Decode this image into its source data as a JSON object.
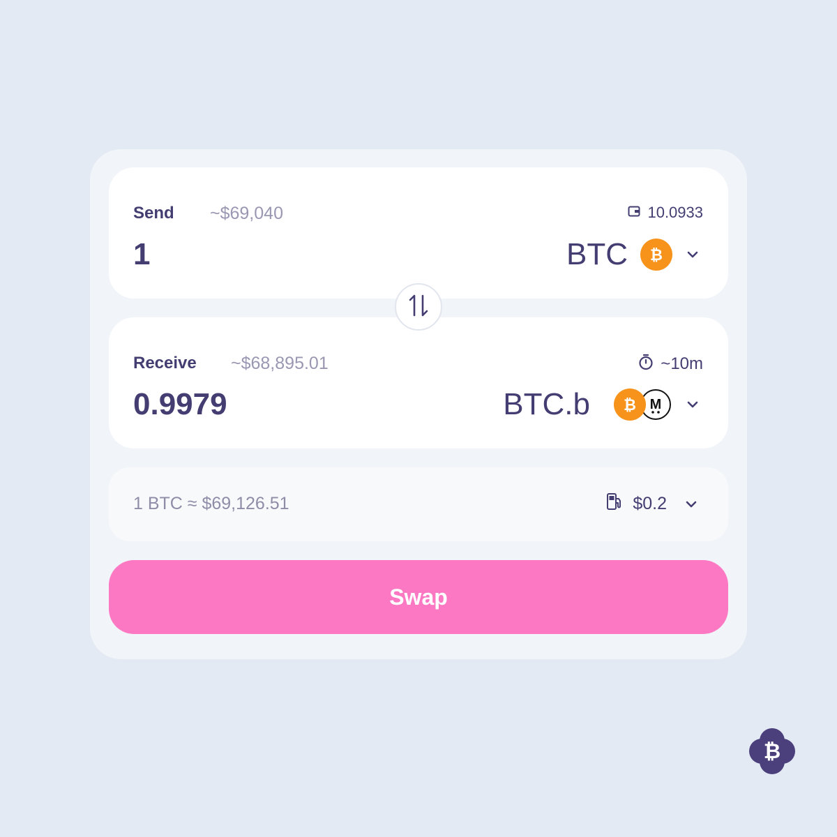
{
  "send": {
    "label": "Send",
    "usd_value": "~$69,040",
    "balance": "10.0933",
    "amount": "1",
    "token": "BTC"
  },
  "receive": {
    "label": "Receive",
    "usd_value": "~$68,895.01",
    "eta": "~10m",
    "amount": "0.9979",
    "token": "BTC.b"
  },
  "rate": {
    "text": "1 BTC ≈ $69,126.51",
    "gas_fee": "$0.2"
  },
  "swap_button": {
    "label": "Swap"
  },
  "colors": {
    "background": "#e3eaf3",
    "card": "#f1f4f8",
    "text": "#433d72",
    "muted": "#9a97b3",
    "btc_orange": "#f7931a",
    "swap_pink": "#fd78c3"
  },
  "icons": [
    "wallet-icon",
    "btc-coin-icon",
    "chevron-down-icon",
    "swap-arrows-icon",
    "timer-icon",
    "mtoken-coin-icon",
    "gas-pump-icon",
    "brand-logo"
  ]
}
